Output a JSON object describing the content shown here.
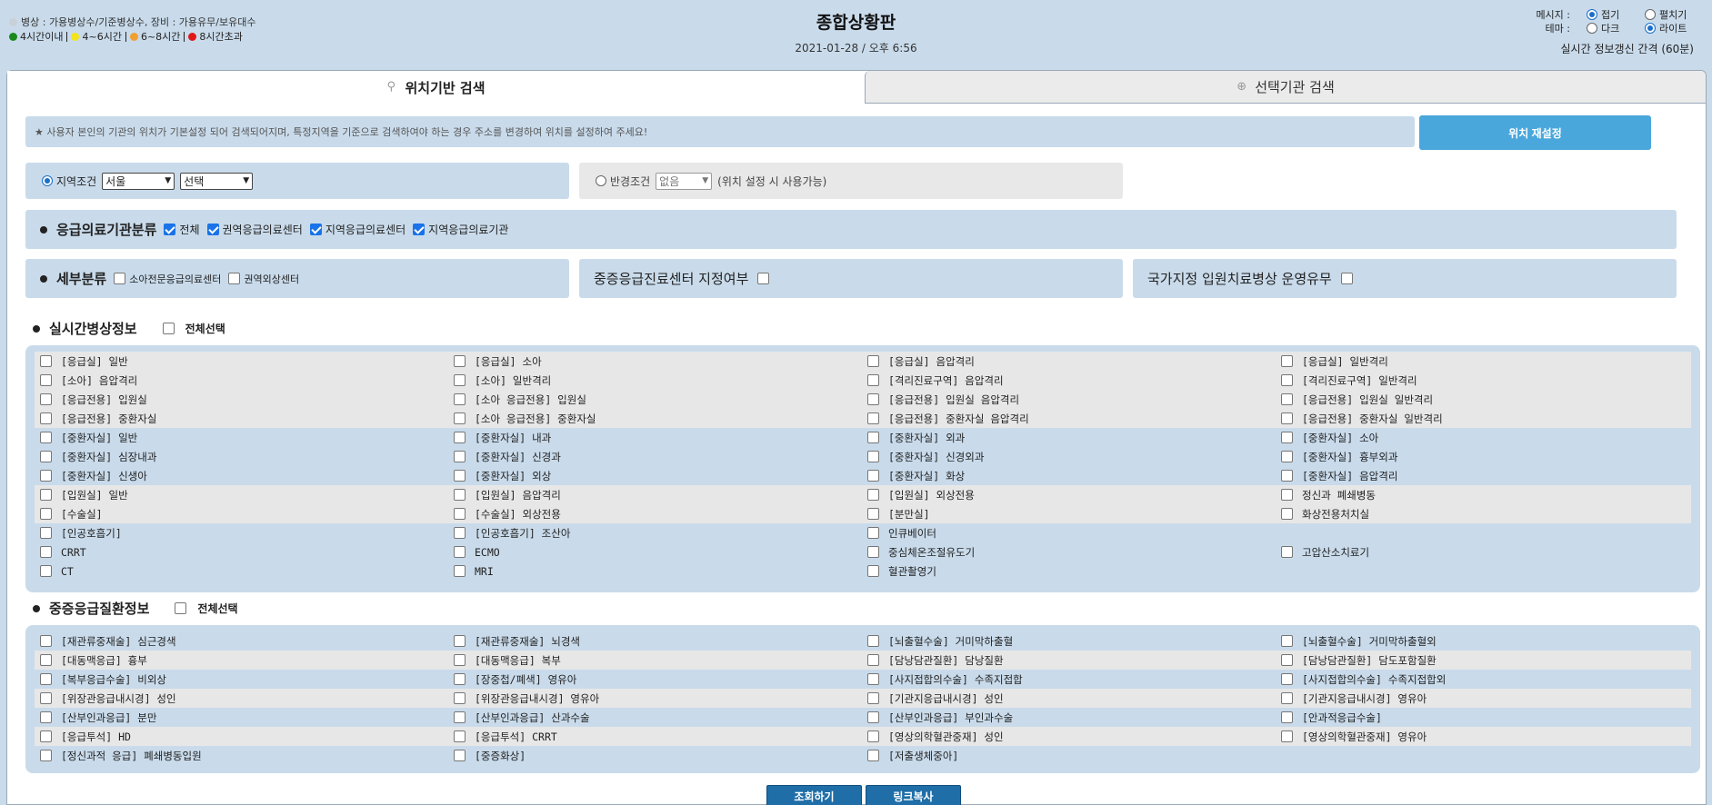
{
  "header": {
    "legend_title": "병상 : 가용병상수/기준병상수, 장비 : 가용유무/보유대수",
    "legend_items": [
      {
        "label": "4시간이내",
        "color": "#1b8a1b"
      },
      {
        "label": "4~6시간",
        "color": "#f2e419"
      },
      {
        "label": "6~8시간",
        "color": "#f0a030"
      },
      {
        "label": "8시간초과",
        "color": "#e01818"
      }
    ],
    "title": "종합상황판",
    "datetime": "2021-01-28 / 오후 6:56",
    "message_label": "메시지 :",
    "message_opt1": "접기",
    "message_opt2": "펼치기",
    "theme_label": "테마 :",
    "theme_opt1": "다크",
    "theme_opt2": "라이트",
    "refresh": "실시간 정보갱신 간격 (60분)"
  },
  "tabs": {
    "location": "위치기반 검색",
    "selected": "선택기관 검색"
  },
  "notice": "★ 사용자 본인의 기관의 위치가 기본설정 되어 검색되어지며, 특정지역을 기준으로 검색하여야 하는 경우 주소를 변경하여 위치를 설정하여 주세요!",
  "reset_button": "위치 재설정",
  "region": {
    "label": "지역조건",
    "city": "서울",
    "district": "선택"
  },
  "radius": {
    "label": "반경조건",
    "value": "없음",
    "note": "(위치 설정 시 사용가능)"
  },
  "classification": {
    "title": "응급의료기관분류",
    "options": [
      "전체",
      "권역응급의료센터",
      "지역응급의료센터",
      "지역응급의료기관"
    ]
  },
  "subclass": {
    "title": "세부분류",
    "options": [
      "소아전문응급의료센터",
      "권역외상센터"
    ]
  },
  "severe_center": "중증응급진료센터 지정여부",
  "national_bed": "국가지정 입원치료병상 운영유무",
  "realtime": {
    "title": "실시간병상정보",
    "select_all": "전체선택",
    "rows": [
      [
        "[응급실] 일반",
        "[응급실] 소아",
        "[응급실] 음압격리",
        "[응급실] 일반격리"
      ],
      [
        "[소아] 음압격리",
        "[소아] 일반격리",
        "[격리진료구역] 음압격리",
        "[격리진료구역] 일반격리"
      ],
      [
        "[응급전용] 입원실",
        "[소아 응급전용] 입원실",
        "[응급전용] 입원실 음압격리",
        "[응급전용] 입원실 일반격리"
      ],
      [
        "[응급전용] 중환자실",
        "[소아 응급전용] 중환자실",
        "[응급전용] 중환자실 음압격리",
        "[응급전용] 중환자실 일반격리"
      ],
      [
        "[중환자실] 일반",
        "[중환자실] 내과",
        "[중환자실] 외과",
        "[중환자실] 소아"
      ],
      [
        "[중환자실] 심장내과",
        "[중환자실] 신경과",
        "[중환자실] 신경외과",
        "[중환자실] 흉부외과"
      ],
      [
        "[중환자실] 신생아",
        "[중환자실] 외상",
        "[중환자실] 화상",
        "[중환자실] 음압격리"
      ],
      [
        "[입원실] 일반",
        "[입원실] 음압격리",
        "[입원실] 외상전용",
        "정신과 폐쇄병동"
      ],
      [
        "[수술실]",
        "[수술실] 외상전용",
        "[분만실]",
        "화상전용처치실"
      ],
      [
        "[인공호흡기]",
        "[인공호흡기] 조산아",
        "인큐베이터",
        ""
      ],
      [
        "CRRT",
        "ECMO",
        "중심체온조절유도기",
        "고압산소치료기"
      ],
      [
        "CT",
        "MRI",
        "혈관촬영기",
        ""
      ]
    ],
    "shade": [
      true,
      true,
      true,
      true,
      false,
      false,
      false,
      true,
      true,
      false,
      false,
      false
    ]
  },
  "severe": {
    "title": "중증응급질환정보",
    "select_all": "전체선택",
    "rows": [
      [
        "[재관류중재술] 심근경색",
        "[재관류중재술] 뇌경색",
        "[뇌출혈수술] 거미막하출혈",
        "[뇌출혈수술] 거미막하출혈외"
      ],
      [
        "[대동맥응급] 흉부",
        "[대동맥응급] 복부",
        "[담낭담관질환] 담낭질환",
        "[담낭담관질환] 담도포함질환"
      ],
      [
        "[복부응급수술] 비외상",
        "[장중첩/폐색] 영유아",
        "[사지접합의수술] 수족지접합",
        "[사지접합의수술] 수족지접합외"
      ],
      [
        "[위장관응급내시경] 성인",
        "[위장관응급내시경] 영유아",
        "[기관지응급내시경] 성인",
        "[기관지응급내시경] 영유아"
      ],
      [
        "[산부인과응급] 분만",
        "[산부인과응급] 산과수술",
        "[산부인과응급] 부인과수술",
        "[안과적응급수술]"
      ],
      [
        "[응급투석] HD",
        "[응급투석] CRRT",
        "[영상의학혈관중재] 성인",
        "[영상의학혈관중재] 영유아"
      ],
      [
        "[정신과적 응급] 폐쇄병동입원",
        "[중증화상]",
        "[저출생체중아]",
        ""
      ]
    ],
    "shade": [
      false,
      true,
      false,
      true,
      false,
      true,
      false
    ]
  },
  "buttons": {
    "search": "조회하기",
    "copy_link": "링크복사"
  }
}
